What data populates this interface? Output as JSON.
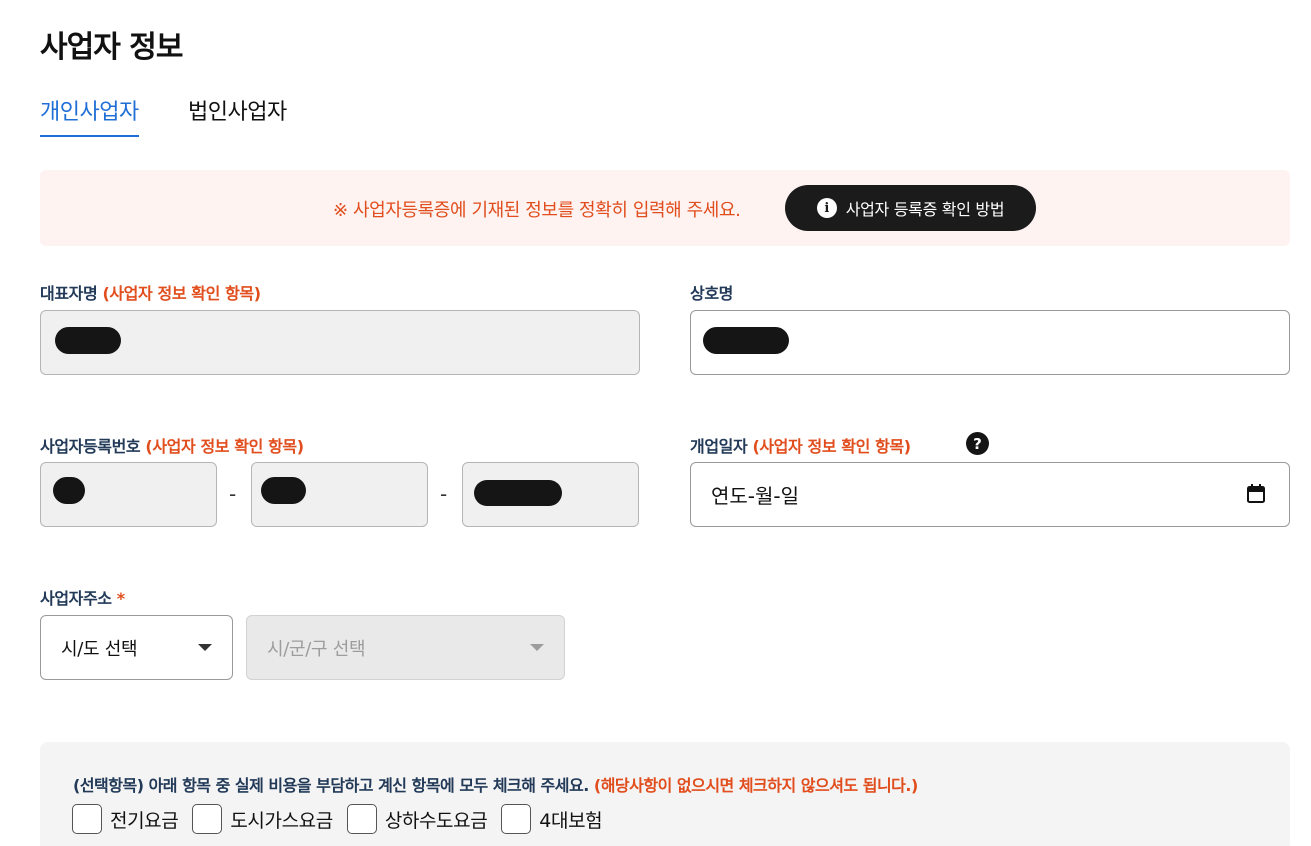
{
  "page": {
    "title": "사업자 정보"
  },
  "tabs": [
    {
      "label": "개인사업자",
      "active": true
    },
    {
      "label": "법인사업자",
      "active": false
    }
  ],
  "notice": {
    "text": "※ 사업자등록증에 기재된 정보를 정확히 입력해 주세요.",
    "button_label": "사업자 등록증 확인 방법",
    "button_icon": "info-icon"
  },
  "form": {
    "representative": {
      "label": "대표자명",
      "hint": "(사업자 정보 확인 항목)",
      "value": "[redacted]"
    },
    "company_name": {
      "label": "상호명",
      "value": "[redacted]"
    },
    "business_number": {
      "label": "사업자등록번호",
      "hint": "(사업자 정보 확인 항목)",
      "separator": "-",
      "parts": [
        "[redacted]",
        "[redacted]",
        "[redacted]"
      ]
    },
    "open_date": {
      "label": "개업일자",
      "hint": "(사업자 정보 확인 항목)",
      "placeholder": "연도-월-일",
      "help_icon": "?"
    },
    "address": {
      "label": "사업자주소",
      "required_mark": "*",
      "province_placeholder": "시/도 선택",
      "city_placeholder": "시/군/구 선택"
    }
  },
  "optional_items": {
    "text": "(선택항목) 아래 항목 중 실제 비용을 부담하고 계신 항목에 모두 체크해 주세요.",
    "hint": "(해당사항이 없으시면 체크하지 않으셔도 됩니다.)",
    "items": [
      "전기요금",
      "도시가스요금",
      "상하수도요금",
      "4대보험"
    ]
  },
  "colors": {
    "accent": "#1f6fd6",
    "warning": "#e14d1c",
    "label": "#223a58",
    "notice_bg": "#fef3f1"
  }
}
